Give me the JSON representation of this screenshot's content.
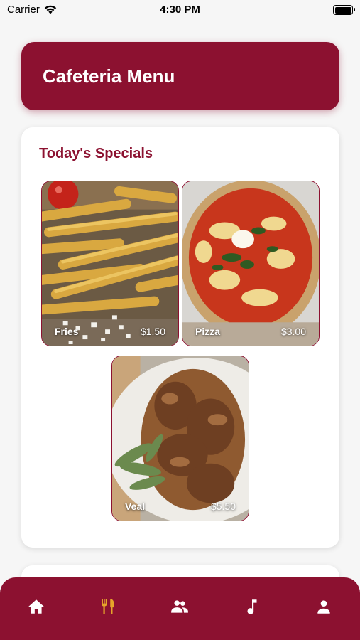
{
  "status": {
    "carrier": "Carrier",
    "time": "4:30 PM",
    "battery_level": 1.0
  },
  "header": {
    "title": "Cafeteria Menu"
  },
  "specials": {
    "title": "Today's Specials",
    "items": [
      {
        "name": "Fries",
        "price": "$1.50"
      },
      {
        "name": "Pizza",
        "price": "$3.00"
      },
      {
        "name": "Veal",
        "price": "$5.50"
      }
    ]
  },
  "tabs": [
    {
      "icon": "home-icon",
      "active": false
    },
    {
      "icon": "fork-knife-icon",
      "active": true
    },
    {
      "icon": "people-icon",
      "active": false
    },
    {
      "icon": "music-note-icon",
      "active": false
    },
    {
      "icon": "person-icon",
      "active": false
    }
  ],
  "colors": {
    "primary": "#8c1130",
    "active_tab": "#e6a52a",
    "inactive_tab": "#ffffff",
    "section_title": "#8c1130"
  }
}
